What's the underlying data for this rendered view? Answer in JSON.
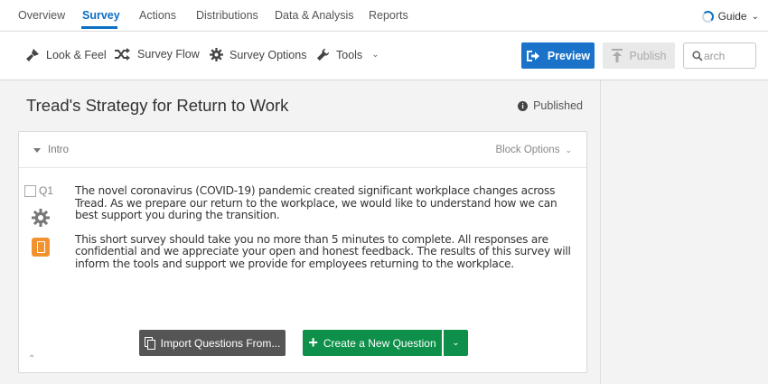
{
  "nav": {
    "tabs": [
      {
        "label": "Overview"
      },
      {
        "label": "Survey"
      },
      {
        "label": "Actions"
      },
      {
        "label": "Distributions"
      },
      {
        "label": "Data & Analysis"
      },
      {
        "label": "Reports"
      }
    ],
    "active_tab": "Survey",
    "guide_label": "Guide",
    "guide_icon": "progress-ring-icon",
    "guide_chevron": "⌄"
  },
  "toolbar": {
    "look_feel": {
      "label": "Look & Feel",
      "icon": "paint-brush-icon"
    },
    "survey_flow": {
      "label": "Survey Flow",
      "icon": "shuffle-icon"
    },
    "survey_options": {
      "label": "Survey Options",
      "icon": "gear-icon"
    },
    "tools": {
      "label": "Tools",
      "icon": "wrench-icon",
      "chevron": "⌄"
    },
    "preview_label": "Preview",
    "publish_label": "Publish",
    "search_placeholder": "arch"
  },
  "survey": {
    "title": "Tread's Strategy for Return to Work",
    "status": "Published",
    "status_icon": "i"
  },
  "block": {
    "name": "Intro",
    "options_label": "Block Options",
    "chevron": "⌄",
    "collapse_caret": "⌃",
    "question": {
      "number": "Q1",
      "paragraphs": [
        "The novel coronavirus (COVID-19) pandemic created significant workplace changes across Tread. As we prepare our return to the workplace, we would like to understand how we can best support you during the transition.",
        "This short survey should take you no more than 5 minutes to complete. All responses are confidential and we appreciate your open and honest feedback. The results of this survey will inform the tools and support we provide for employees returning to the workplace."
      ]
    },
    "import_label": "Import Questions From...",
    "create_label": "Create a New Question",
    "create_plus": "+",
    "create_dropdown": "⌄"
  },
  "colors": {
    "accent": "#0b6fc4",
    "preview_bg": "#1a73c9",
    "create_bg": "#0e8f4a",
    "mobile_icon": "#f2922f",
    "import_bg": "#555555"
  }
}
